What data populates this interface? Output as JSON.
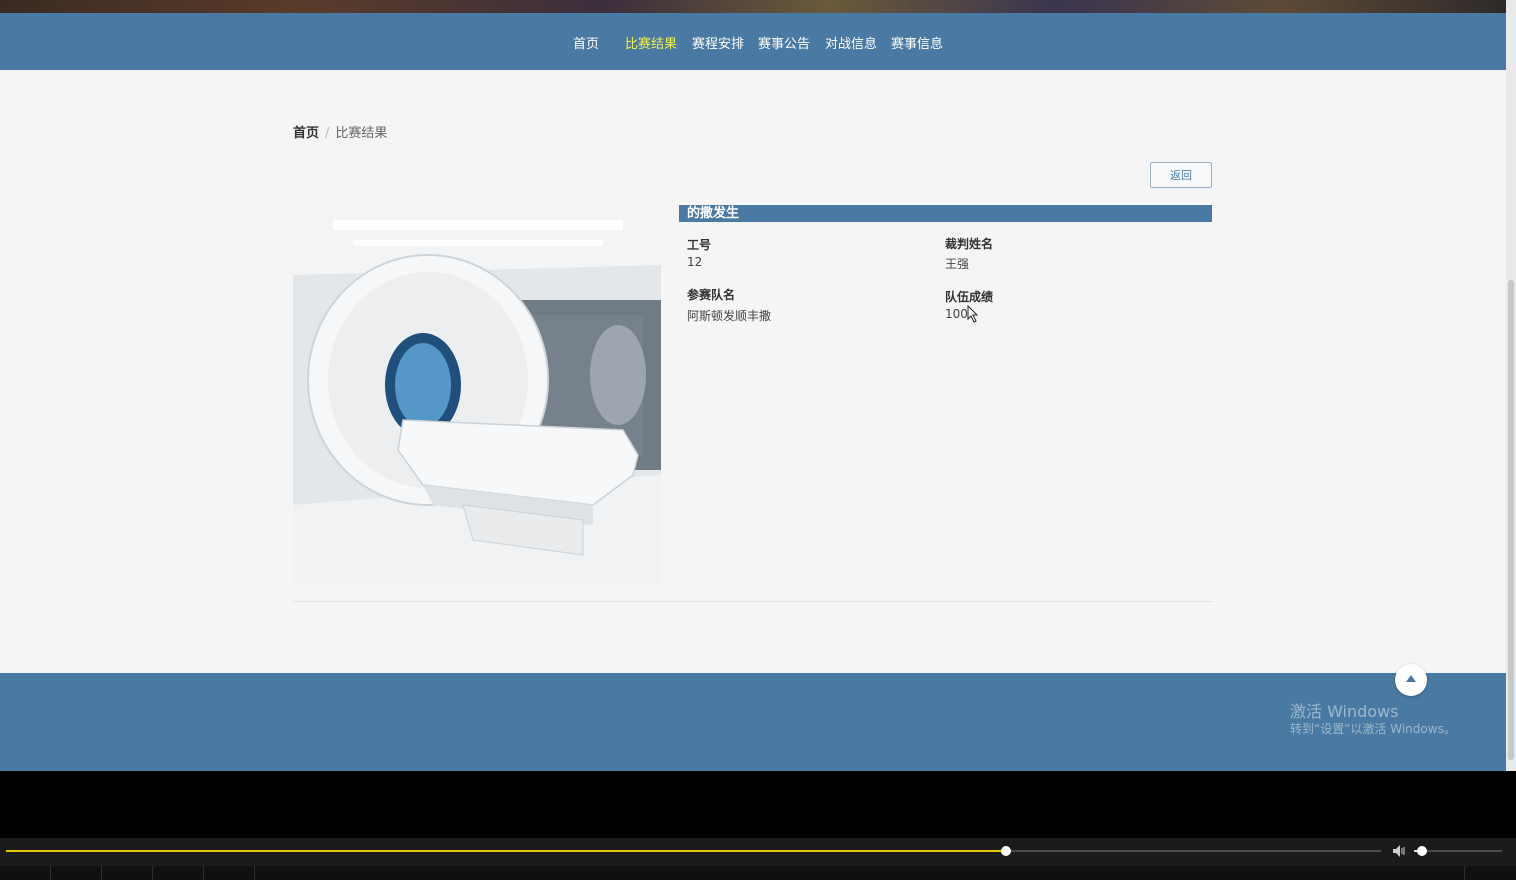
{
  "nav": {
    "items": [
      {
        "label": "首页",
        "active": false
      },
      {
        "label": "比赛结果",
        "active": true
      },
      {
        "label": "赛程安排",
        "active": false
      },
      {
        "label": "赛事公告",
        "active": false
      },
      {
        "label": "对战信息",
        "active": false
      },
      {
        "label": "赛事信息",
        "active": false
      }
    ]
  },
  "breadcrumb": {
    "home": "首页",
    "separator": "/",
    "current": "比赛结果"
  },
  "back_button": {
    "label": "返回"
  },
  "detail": {
    "title": "的撒发生",
    "fields": {
      "job_no": {
        "label": "工号",
        "value": "12"
      },
      "referee_name": {
        "label": "裁判姓名",
        "value": "王强"
      },
      "team_name": {
        "label": "参赛队名",
        "value": "阿斯顿发顺丰撒"
      },
      "team_score": {
        "label": "队伍成绩",
        "value": "100"
      }
    }
  },
  "watermark": {
    "line1": "激活 Windows",
    "line2": "转到“设置”以激活 Windows。"
  },
  "player": {
    "progress": 0.727,
    "volume": 0.09
  },
  "colors": {
    "brand": "#4a7aa3",
    "nav_active": "#f2f04a",
    "progress": "#e6c300"
  },
  "icons": {
    "scroll_top": "arrow-up-icon",
    "volume": "speaker-icon"
  }
}
